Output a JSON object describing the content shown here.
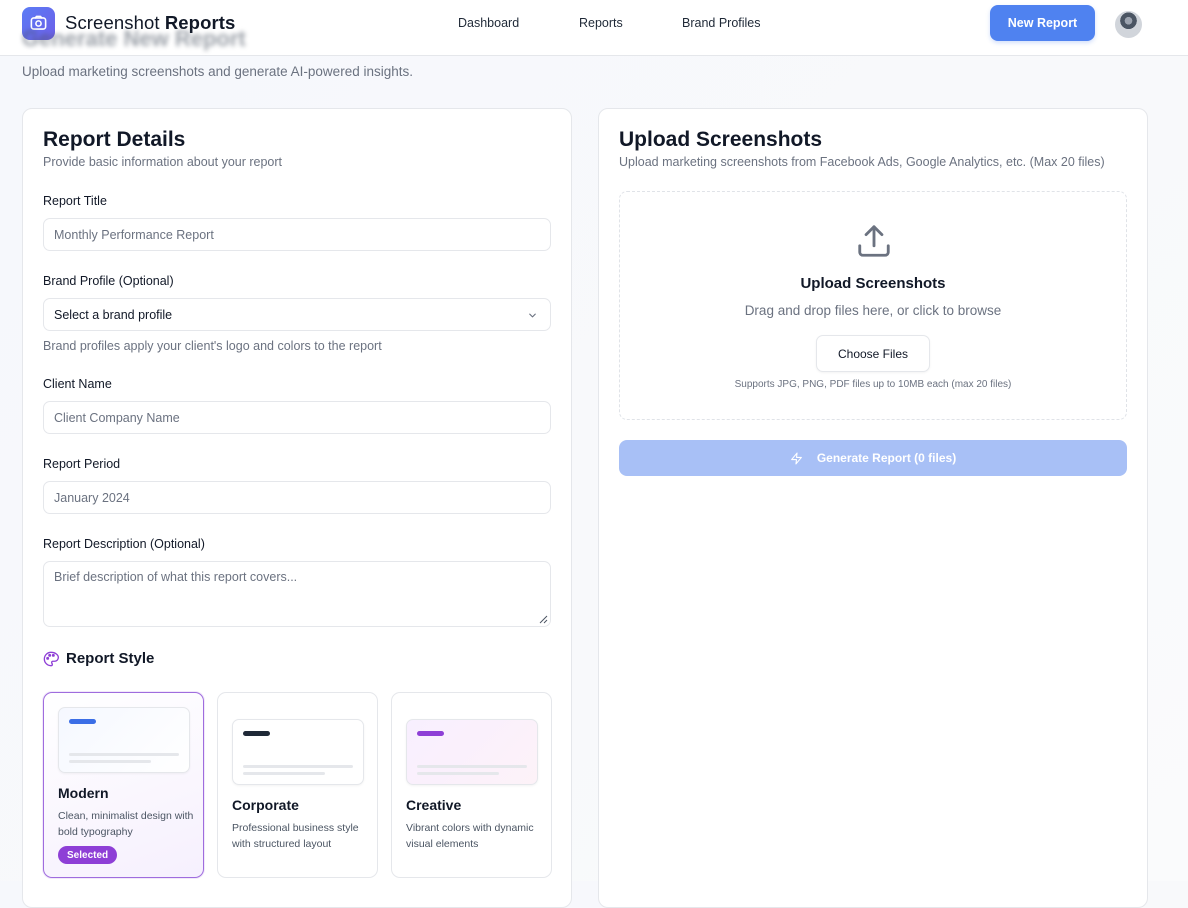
{
  "app": {
    "name_regular": "Screenshot ",
    "name_bold": "Reports"
  },
  "nav": {
    "links": [
      {
        "label": "Dashboard"
      },
      {
        "label": "Reports"
      },
      {
        "label": "Brand Profiles"
      }
    ],
    "new_report_label": "New Report"
  },
  "page": {
    "title": "Generate New Report",
    "subtitle": "Upload marketing screenshots and generate AI-powered insights."
  },
  "details": {
    "title": "Report Details",
    "description": "Provide basic information about your report",
    "report_title_label": "Report Title",
    "report_title_placeholder": "Monthly Performance Report",
    "brand_profile_label": "Brand Profile (Optional)",
    "brand_profile_value": "Select a brand profile",
    "brand_profile_help": "Brand profiles apply your client's logo and colors to the report",
    "client_name_label": "Client Name",
    "client_name_placeholder": "Client Company Name",
    "period_label": "Report Period",
    "period_placeholder": "January 2024",
    "description_label": "Report Description (Optional)",
    "description_placeholder": "Brief description of what this report covers..."
  },
  "report_style": {
    "heading": "Report Style",
    "options": [
      {
        "name": "Modern",
        "description": "Clean, minimalist design with bold typography",
        "accent": "#3b6ee6",
        "selected": true
      },
      {
        "name": "Corporate",
        "description": "Professional business style with structured layout",
        "accent": "#1f2937",
        "selected": false
      },
      {
        "name": "Creative",
        "description": "Vibrant colors with dynamic visual elements",
        "accent": "#8e3fd6",
        "selected": false
      }
    ],
    "selected_badge": "Selected"
  },
  "upload": {
    "title": "Upload Screenshots",
    "description": "Upload marketing screenshots from Facebook Ads, Google Analytics, etc. (Max 20 files)",
    "dropzone_title": "Upload Screenshots",
    "dropzone_subtitle": "Drag and drop files here, or click to browse",
    "choose_files_label": "Choose Files",
    "supported_note": "Supports JPG, PNG, PDF files up to 10MB each (max 20 files)",
    "generate_label": "Generate Report (0 files)"
  },
  "colors": {
    "primary": "#4f82f0",
    "primary_disabled": "#a8c0f6",
    "selected_purple": "#8e3fd6"
  },
  "icons": {
    "logo": "camera-icon",
    "select": "chevron-down-icon",
    "style": "palette-icon",
    "upload": "upload-icon",
    "generate": "lightning-icon"
  }
}
